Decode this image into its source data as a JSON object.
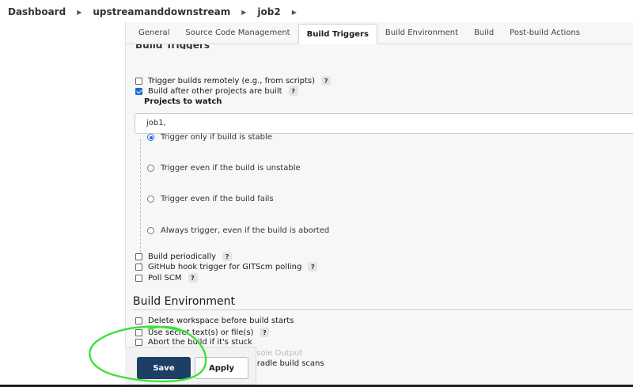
{
  "breadcrumb": {
    "items": [
      "Dashboard",
      "upstreamanddownstream",
      "job2"
    ]
  },
  "tabs": [
    {
      "label": "General",
      "active": false
    },
    {
      "label": "Source Code Management",
      "active": false
    },
    {
      "label": "Build Triggers",
      "active": true
    },
    {
      "label": "Build Environment",
      "active": false
    },
    {
      "label": "Build",
      "active": false
    },
    {
      "label": "Post-build Actions",
      "active": false
    }
  ],
  "build_triggers": {
    "heading": "Build Triggers",
    "trigger_remotely": {
      "label": "Trigger builds remotely (e.g., from scripts)",
      "checked": false
    },
    "build_after_other": {
      "label": "Build after other projects are built",
      "checked": true
    },
    "projects_to_watch_label": "Projects to watch",
    "projects_to_watch_value": "job1,",
    "radio_options": [
      {
        "label": "Trigger only if build is stable",
        "selected": true
      },
      {
        "label": "Trigger even if the build is unstable",
        "selected": false
      },
      {
        "label": "Trigger even if the build fails",
        "selected": false
      },
      {
        "label": "Always trigger, even if the build is aborted",
        "selected": false
      }
    ],
    "build_periodically": {
      "label": "Build periodically",
      "checked": false
    },
    "github_hook": {
      "label": "GitHub hook trigger for GITScm polling",
      "checked": false
    },
    "poll_scm": {
      "label": "Poll SCM",
      "checked": false
    },
    "help_glyph": "?"
  },
  "build_environment": {
    "title": "Build Environment",
    "delete_workspace": {
      "label": "Delete workspace before build starts",
      "checked": false
    },
    "use_secret": {
      "label": "Use secret text(s) or file(s)",
      "checked": false
    },
    "abort_if_stuck": {
      "label": "Abort the build if it's stuck",
      "checked": false
    },
    "add_timestamps": {
      "label": "Add timestamps to the Console Output",
      "checked": false
    },
    "gradle_scans_partial": "Gradle build scans"
  },
  "actions": {
    "save_label": "Save",
    "apply_label": "Apply"
  },
  "colors": {
    "accent": "#1d6bd6",
    "save_button": "#1d3f66",
    "annotation_green": "#3ee03a"
  }
}
